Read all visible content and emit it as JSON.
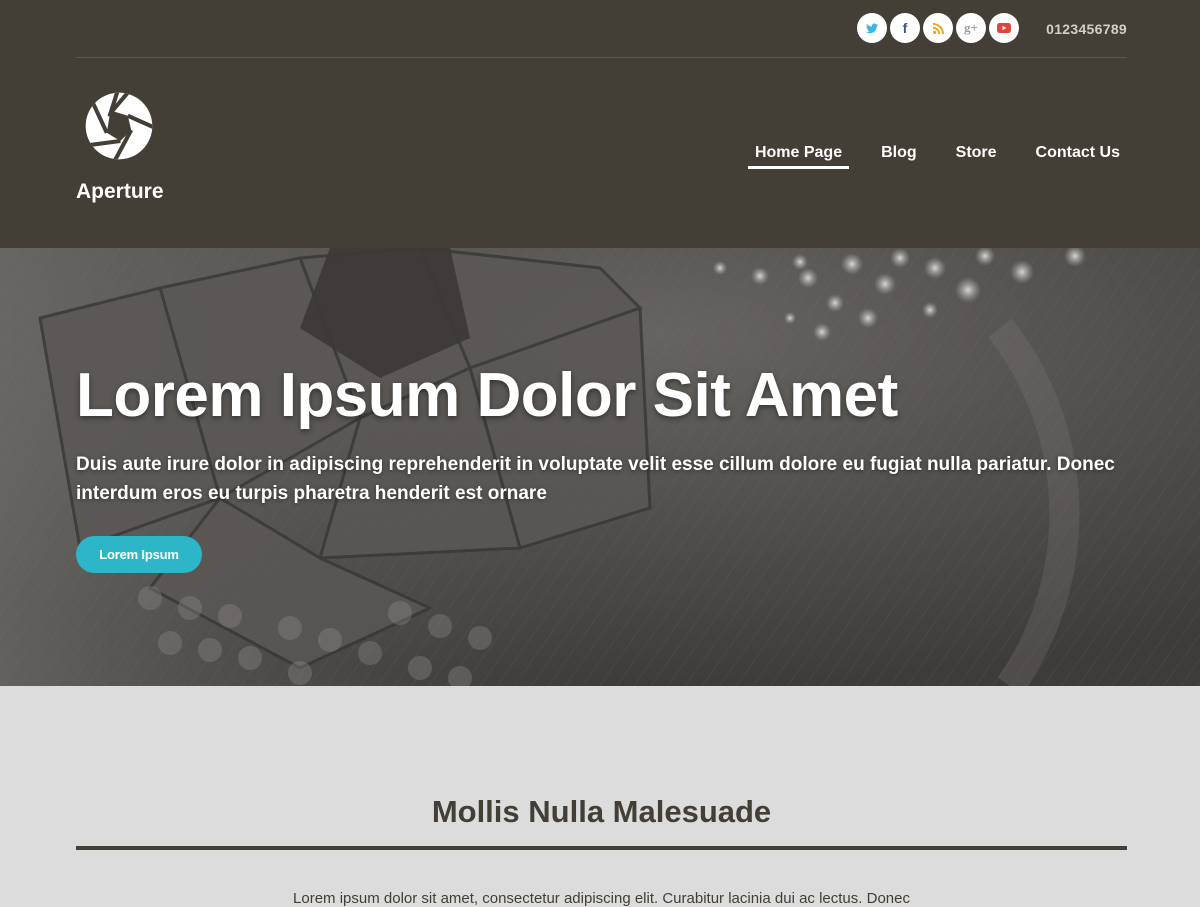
{
  "header": {
    "phone": "0123456789",
    "social": [
      {
        "name": "twitter-icon",
        "glyph": "",
        "color": "#3cb6e3"
      },
      {
        "name": "facebook-icon",
        "glyph": "f",
        "color": "#3b5998"
      },
      {
        "name": "rss-icon",
        "glyph": "",
        "color": "#f4a11d"
      },
      {
        "name": "google-plus-icon",
        "glyph": "g+",
        "color": "#9b9b9b"
      },
      {
        "name": "youtube-icon",
        "glyph": "",
        "color": "#e0473c"
      }
    ],
    "logo": {
      "text": "Aperture",
      "icon": "aperture-icon"
    },
    "nav": [
      {
        "label": "Home Page",
        "active": true
      },
      {
        "label": "Blog",
        "active": false
      },
      {
        "label": "Store",
        "active": false
      },
      {
        "label": "Contact Us",
        "active": false
      }
    ]
  },
  "hero": {
    "title": "Lorem Ipsum Dolor Sit Amet",
    "subtitle": "Duis aute irure dolor in adipiscing reprehenderit in voluptate velit esse cillum dolore eu fugiat nulla pariatur. Donec interdum eros eu turpis pharetra henderit est ornare",
    "button_label": "Lorem Ipsum",
    "accent": "#2db5c8"
  },
  "section": {
    "title": "Mollis Nulla Malesuade",
    "text": "Lorem ipsum dolor sit amet, consectetur adipiscing elit. Curabitur lacinia dui ac lectus. Donec"
  },
  "colors": {
    "header_bg": "#433e36",
    "section_bg": "#dcdcdc",
    "text_dark": "#433e36"
  }
}
